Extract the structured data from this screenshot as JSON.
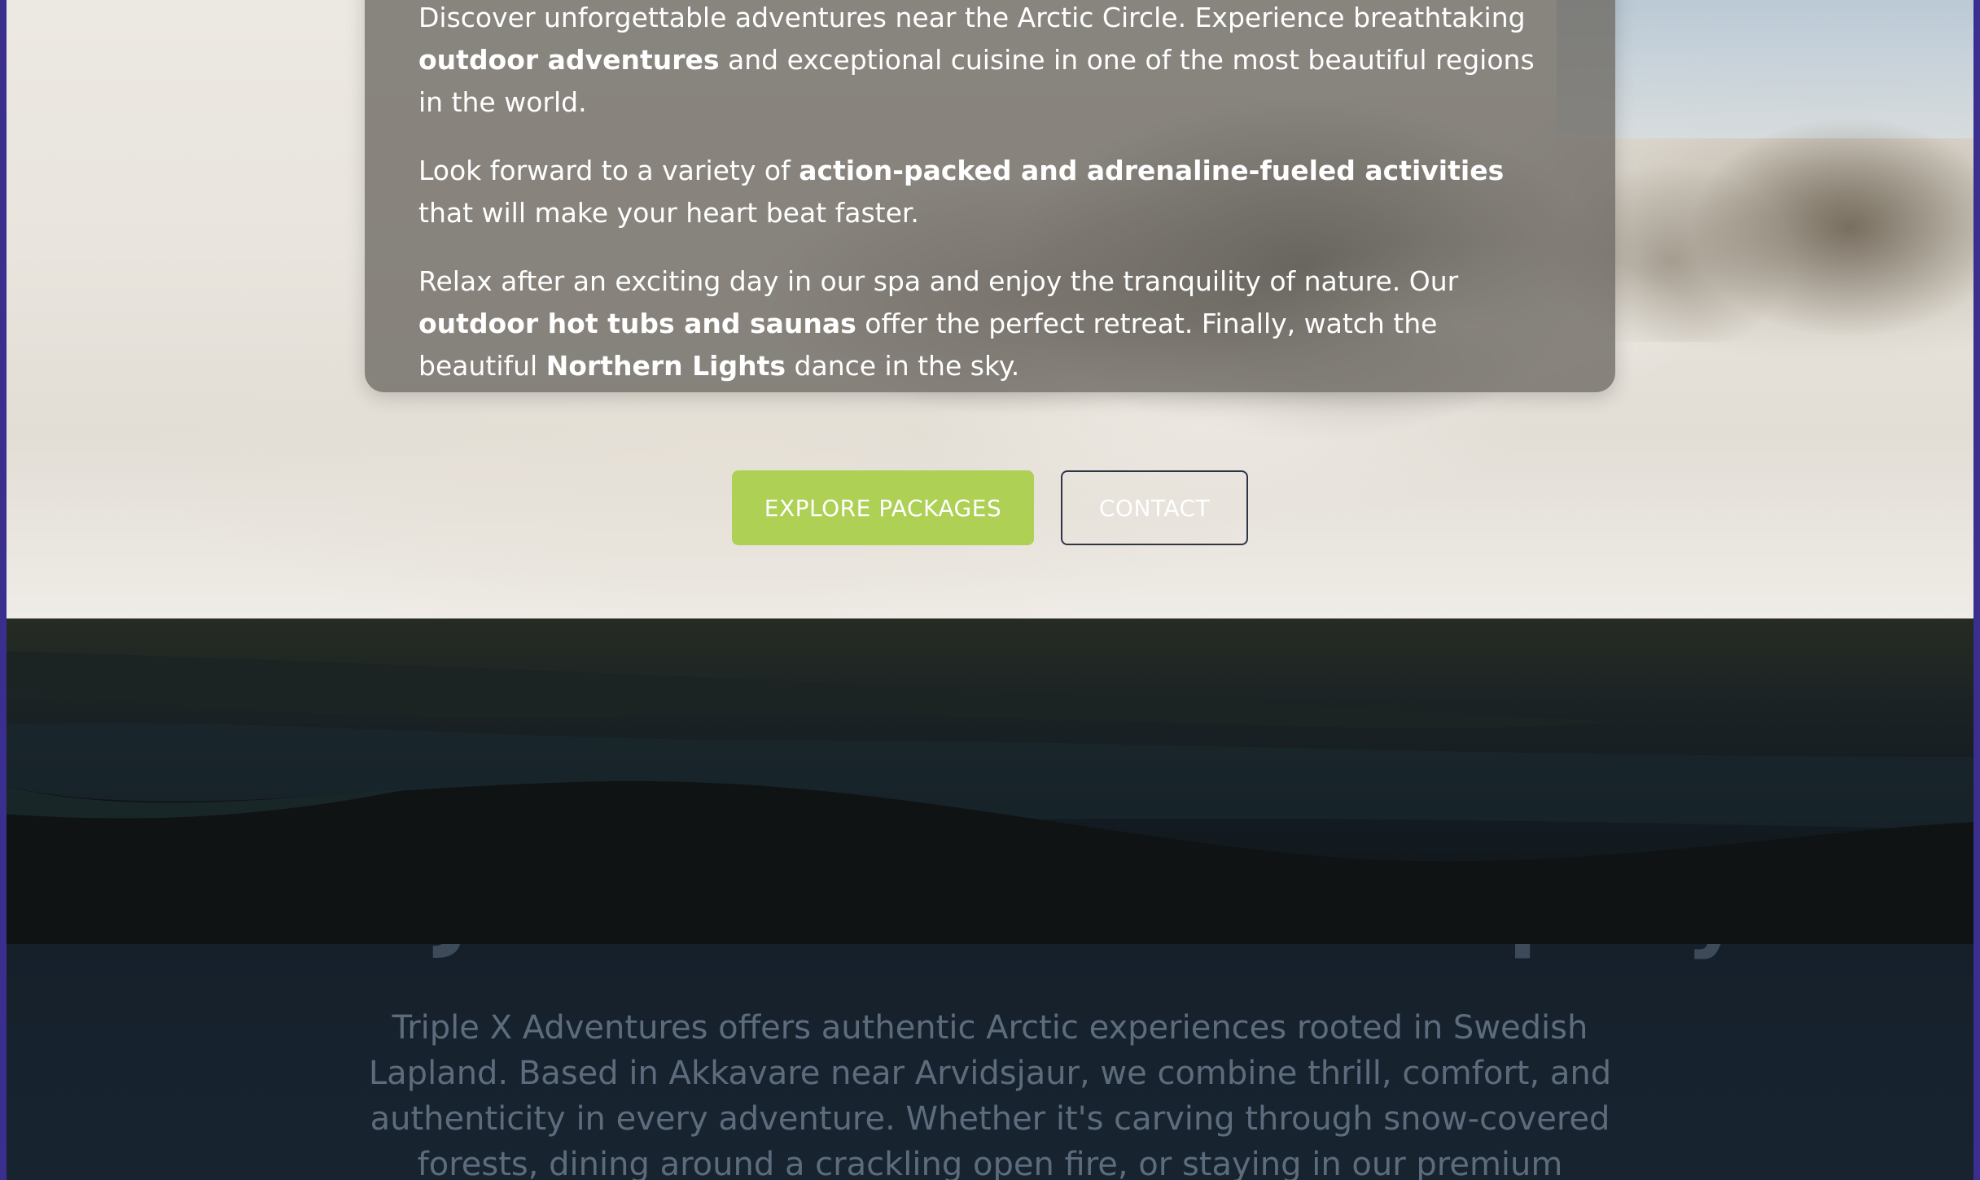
{
  "hero": {
    "intro": {
      "part1": "Discover unforgettable adventures near the Arctic Circle. Experience breathtaking ",
      "bold1": "outdoor adventures",
      "part2": " and exceptional cuisine in one of the most beautiful regions in the world."
    },
    "activities": {
      "part1": "Look forward to a variety of ",
      "bold1": "action-packed and adrenaline-fueled activities",
      "part2": " that will make your heart beat faster."
    },
    "relax": {
      "part1": "Relax after an exciting day in our spa and enjoy the tranquility of nature. Our ",
      "bold1": "outdoor hot tubs and saunas",
      "part2": " offer the perfect retreat. Finally, watch the beautiful ",
      "bold2": "Northern Lights",
      "part3": " dance in the sky."
    },
    "buttons": {
      "explore": "EXPLORE PACKAGES",
      "contact": "CONTACT"
    }
  },
  "about": {
    "title": "Not Just Another Tour Company",
    "text": "Triple X Adventures offers authentic Arctic experiences rooted in Swedish Lapland. Based in Akkavare near Arvidsjaur, we combine thrill, comfort, and authenticity in every adventure. Whether it's carving through snow-covered forests, dining around a crackling open fire, or staying in our premium accommodations, you'll"
  },
  "colors": {
    "accent": "#aed055",
    "frame": "#3a2f8f",
    "dark_section": "#16202b"
  }
}
